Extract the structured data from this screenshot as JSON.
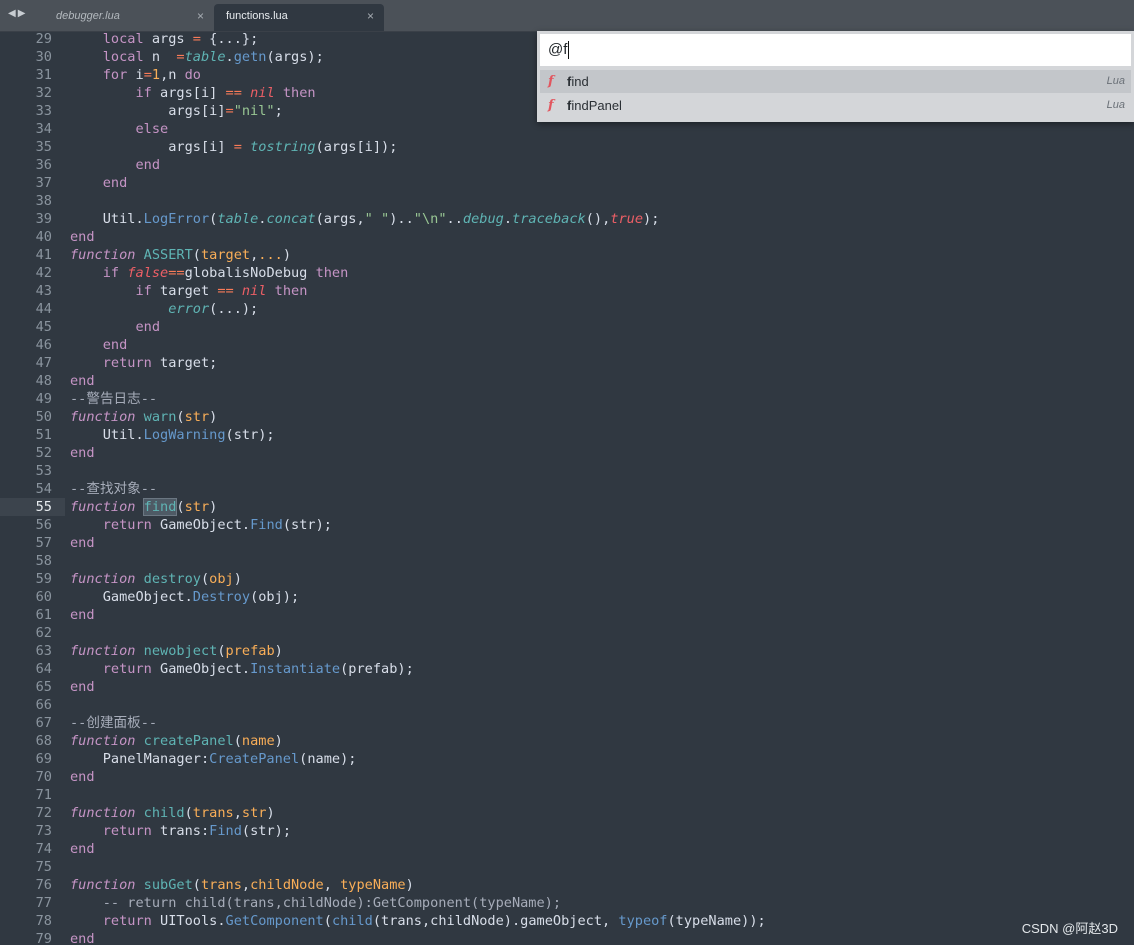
{
  "tabs": [
    {
      "label": "debugger.lua",
      "active": false
    },
    {
      "label": "functions.lua",
      "active": true
    }
  ],
  "tab_close_glyph": "×",
  "palette": {
    "query": "@f",
    "items": [
      {
        "icon": "f",
        "match": "f",
        "rest": "ind",
        "kind": "Lua",
        "selected": true
      },
      {
        "icon": "f",
        "match": "f",
        "rest": "indPanel",
        "kind": "Lua",
        "selected": false
      }
    ]
  },
  "current_line": 55,
  "lines": [
    {
      "n": "29"
    },
    {
      "n": "30"
    },
    {
      "n": "31"
    },
    {
      "n": "32"
    },
    {
      "n": "33"
    },
    {
      "n": "34"
    },
    {
      "n": "35"
    },
    {
      "n": "36"
    },
    {
      "n": "37"
    },
    {
      "n": "38"
    },
    {
      "n": "39"
    },
    {
      "n": "40"
    },
    {
      "n": "41"
    },
    {
      "n": "42"
    },
    {
      "n": "43"
    },
    {
      "n": "44"
    },
    {
      "n": "45"
    },
    {
      "n": "46"
    },
    {
      "n": "47"
    },
    {
      "n": "48"
    },
    {
      "n": "49"
    },
    {
      "n": "50"
    },
    {
      "n": "51"
    },
    {
      "n": "52"
    },
    {
      "n": "53"
    },
    {
      "n": "54"
    },
    {
      "n": "55"
    },
    {
      "n": "56"
    },
    {
      "n": "57"
    },
    {
      "n": "58"
    },
    {
      "n": "59"
    },
    {
      "n": "60"
    },
    {
      "n": "61"
    },
    {
      "n": "62"
    },
    {
      "n": "63"
    },
    {
      "n": "64"
    },
    {
      "n": "65"
    },
    {
      "n": "66"
    },
    {
      "n": "67"
    },
    {
      "n": "68"
    },
    {
      "n": "69"
    },
    {
      "n": "70"
    },
    {
      "n": "71"
    },
    {
      "n": "72"
    },
    {
      "n": "73"
    },
    {
      "n": "74"
    },
    {
      "n": "75"
    },
    {
      "n": "76"
    },
    {
      "n": "77"
    },
    {
      "n": "78"
    },
    {
      "n": "79"
    }
  ],
  "code": {
    "l29": [
      [
        "    ",
        ""
      ],
      [
        "local",
        "kw"
      ],
      [
        " args ",
        ""
      ],
      [
        "=",
        "op"
      ],
      [
        " {...};",
        ""
      ]
    ],
    "l30": [
      [
        "    ",
        ""
      ],
      [
        "local",
        "kw"
      ],
      [
        " n  ",
        ""
      ],
      [
        "=",
        "op"
      ],
      [
        "table",
        "lib"
      ],
      [
        ".",
        ""
      ],
      [
        "getn",
        "call"
      ],
      [
        "(args);",
        ""
      ]
    ],
    "l31": [
      [
        "    ",
        ""
      ],
      [
        "for",
        "kw"
      ],
      [
        " i",
        ""
      ],
      [
        "=",
        "op"
      ],
      [
        "1",
        "num"
      ],
      [
        ",n ",
        ""
      ],
      [
        "do",
        "kw"
      ]
    ],
    "l32": [
      [
        "        ",
        ""
      ],
      [
        "if",
        "kw"
      ],
      [
        " args[i] ",
        ""
      ],
      [
        "==",
        "op"
      ],
      [
        " ",
        ""
      ],
      [
        "nil",
        "nil"
      ],
      [
        " ",
        ""
      ],
      [
        "then",
        "kw"
      ]
    ],
    "l33": [
      [
        "            args[i]",
        ""
      ],
      [
        "=",
        "op"
      ],
      [
        "\"nil\"",
        "str"
      ],
      [
        ";",
        ""
      ]
    ],
    "l34": [
      [
        "        ",
        ""
      ],
      [
        "else",
        "kw"
      ]
    ],
    "l35": [
      [
        "            args[i] ",
        ""
      ],
      [
        "=",
        "op"
      ],
      [
        " ",
        ""
      ],
      [
        "tostring",
        "lib"
      ],
      [
        "(args[i]);",
        ""
      ]
    ],
    "l36": [
      [
        "        ",
        ""
      ],
      [
        "end",
        "kw"
      ]
    ],
    "l37": [
      [
        "    ",
        ""
      ],
      [
        "end",
        "kw"
      ]
    ],
    "l38": [
      [
        "",
        ""
      ]
    ],
    "l39": [
      [
        "    Util.",
        ""
      ],
      [
        "LogError",
        "call"
      ],
      [
        "(",
        ""
      ],
      [
        "table",
        "lib"
      ],
      [
        ".",
        ""
      ],
      [
        "concat",
        "lib"
      ],
      [
        "(args,",
        ""
      ],
      [
        "\" \"",
        "str"
      ],
      [
        ")..",
        ""
      ],
      [
        "\"\\n\"",
        "str"
      ],
      [
        "..",
        ""
      ],
      [
        "debug",
        "lib"
      ],
      [
        ".",
        ""
      ],
      [
        "traceback",
        "lib"
      ],
      [
        "(),",
        ""
      ],
      [
        "true",
        "nil"
      ],
      [
        ");",
        ""
      ]
    ],
    "l40": [
      [
        "end",
        "kw"
      ]
    ],
    "l41": [
      [
        "function",
        "kw it"
      ],
      [
        " ",
        ""
      ],
      [
        "ASSERT",
        "fnname"
      ],
      [
        "(",
        ""
      ],
      [
        "target",
        "param"
      ],
      [
        ",",
        ""
      ],
      [
        "...",
        "param"
      ],
      [
        ")",
        ""
      ]
    ],
    "l42": [
      [
        "    ",
        ""
      ],
      [
        "if",
        "kw"
      ],
      [
        " ",
        ""
      ],
      [
        "false",
        "nil"
      ],
      [
        "==",
        "op"
      ],
      [
        "globalisNoDebug ",
        ""
      ],
      [
        "then",
        "kw"
      ]
    ],
    "l43": [
      [
        "        ",
        ""
      ],
      [
        "if",
        "kw"
      ],
      [
        " target ",
        ""
      ],
      [
        "==",
        "op"
      ],
      [
        " ",
        ""
      ],
      [
        "nil",
        "nil"
      ],
      [
        " ",
        ""
      ],
      [
        "then",
        "kw"
      ]
    ],
    "l44": [
      [
        "            ",
        ""
      ],
      [
        "error",
        "lib"
      ],
      [
        "(...);",
        ""
      ]
    ],
    "l45": [
      [
        "        ",
        ""
      ],
      [
        "end",
        "kw"
      ]
    ],
    "l46": [
      [
        "    ",
        ""
      ],
      [
        "end",
        "kw"
      ]
    ],
    "l47": [
      [
        "    ",
        ""
      ],
      [
        "return",
        "kw"
      ],
      [
        " target;",
        ""
      ]
    ],
    "l48": [
      [
        "end",
        "kw"
      ]
    ],
    "l49": [
      [
        "--警告日志--",
        "cm"
      ]
    ],
    "l50": [
      [
        "function",
        "kw it"
      ],
      [
        " ",
        ""
      ],
      [
        "warn",
        "fnname"
      ],
      [
        "(",
        ""
      ],
      [
        "str",
        "param"
      ],
      [
        ")",
        ""
      ]
    ],
    "l51": [
      [
        "    Util.",
        ""
      ],
      [
        "LogWarning",
        "call"
      ],
      [
        "(str);",
        ""
      ]
    ],
    "l52": [
      [
        "end",
        "kw"
      ]
    ],
    "l53": [
      [
        "",
        ""
      ]
    ],
    "l54": [
      [
        "--查找对象--",
        "cm"
      ]
    ],
    "l55": [
      [
        "function",
        "kw it"
      ],
      [
        " ",
        ""
      ],
      [
        "find",
        "fnname selword"
      ],
      [
        "(",
        ""
      ],
      [
        "str",
        "param"
      ],
      [
        ")",
        ""
      ]
    ],
    "l56": [
      [
        "    ",
        ""
      ],
      [
        "return",
        "kw"
      ],
      [
        " GameObject.",
        ""
      ],
      [
        "Find",
        "call"
      ],
      [
        "(str);",
        ""
      ]
    ],
    "l57": [
      [
        "end",
        "kw"
      ]
    ],
    "l58": [
      [
        "",
        ""
      ]
    ],
    "l59": [
      [
        "function",
        "kw it"
      ],
      [
        " ",
        ""
      ],
      [
        "destroy",
        "fnname"
      ],
      [
        "(",
        ""
      ],
      [
        "obj",
        "param"
      ],
      [
        ")",
        ""
      ]
    ],
    "l60": [
      [
        "    GameObject.",
        ""
      ],
      [
        "Destroy",
        "call"
      ],
      [
        "(obj);",
        ""
      ]
    ],
    "l61": [
      [
        "end",
        "kw"
      ]
    ],
    "l62": [
      [
        "",
        ""
      ]
    ],
    "l63": [
      [
        "function",
        "kw it"
      ],
      [
        " ",
        ""
      ],
      [
        "newobject",
        "fnname"
      ],
      [
        "(",
        ""
      ],
      [
        "prefab",
        "param"
      ],
      [
        ")",
        ""
      ]
    ],
    "l64": [
      [
        "    ",
        ""
      ],
      [
        "return",
        "kw"
      ],
      [
        " GameObject.",
        ""
      ],
      [
        "Instantiate",
        "call"
      ],
      [
        "(prefab);",
        ""
      ]
    ],
    "l65": [
      [
        "end",
        "kw"
      ]
    ],
    "l66": [
      [
        "",
        ""
      ]
    ],
    "l67": [
      [
        "--创建面板--",
        "cm"
      ]
    ],
    "l68": [
      [
        "function",
        "kw it"
      ],
      [
        " ",
        ""
      ],
      [
        "createPanel",
        "fnname"
      ],
      [
        "(",
        ""
      ],
      [
        "name",
        "param"
      ],
      [
        ")",
        ""
      ]
    ],
    "l69": [
      [
        "    PanelManager:",
        ""
      ],
      [
        "CreatePanel",
        "call"
      ],
      [
        "(name);",
        ""
      ]
    ],
    "l70": [
      [
        "end",
        "kw"
      ]
    ],
    "l71": [
      [
        "",
        ""
      ]
    ],
    "l72": [
      [
        "function",
        "kw it"
      ],
      [
        " ",
        ""
      ],
      [
        "child",
        "fnname"
      ],
      [
        "(",
        ""
      ],
      [
        "trans",
        "param"
      ],
      [
        ",",
        ""
      ],
      [
        "str",
        "param"
      ],
      [
        ")",
        ""
      ]
    ],
    "l73": [
      [
        "    ",
        ""
      ],
      [
        "return",
        "kw"
      ],
      [
        " trans:",
        ""
      ],
      [
        "Find",
        "call"
      ],
      [
        "(str);",
        ""
      ]
    ],
    "l74": [
      [
        "end",
        "kw"
      ]
    ],
    "l75": [
      [
        "",
        ""
      ]
    ],
    "l76": [
      [
        "function",
        "kw it"
      ],
      [
        " ",
        ""
      ],
      [
        "subGet",
        "fnname"
      ],
      [
        "(",
        ""
      ],
      [
        "trans",
        "param"
      ],
      [
        ",",
        ""
      ],
      [
        "childNode",
        "param"
      ],
      [
        ", ",
        ""
      ],
      [
        "typeName",
        "param"
      ],
      [
        ")",
        ""
      ]
    ],
    "l77": [
      [
        "    -- return child(trans,childNode):GetComponent(typeName);",
        "cm"
      ]
    ],
    "l78": [
      [
        "    ",
        ""
      ],
      [
        "return",
        "kw"
      ],
      [
        " UITools.",
        ""
      ],
      [
        "GetComponent",
        "call"
      ],
      [
        "(",
        ""
      ],
      [
        "child",
        "call"
      ],
      [
        "(trans,childNode).gameObject, ",
        ""
      ],
      [
        "typeof",
        "call"
      ],
      [
        "(typeName));",
        ""
      ]
    ],
    "l79": [
      [
        "end",
        "kw"
      ]
    ]
  },
  "watermark": "CSDN @阿赵3D"
}
